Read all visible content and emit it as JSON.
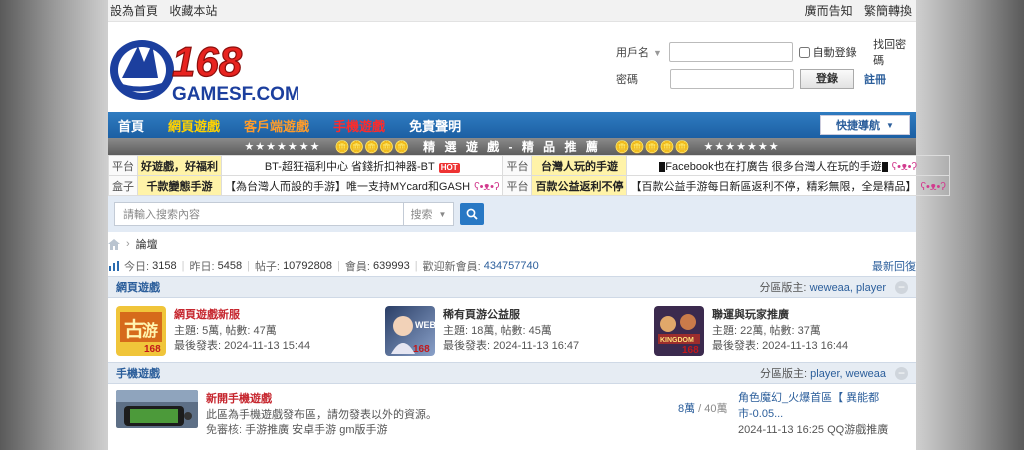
{
  "topbar": {
    "left": [
      "設為首頁",
      "收藏本站"
    ],
    "right": [
      "廣而告知",
      "繁簡轉換"
    ]
  },
  "logo": {
    "number": "168",
    "text": "GAMESF.COM"
  },
  "login": {
    "username_label": "用戶名",
    "password_label": "密碼",
    "remember_label": "自動登錄",
    "login_button": "登錄",
    "forgot_link": "找回密碼",
    "register_link": "註冊"
  },
  "nav": {
    "items": [
      {
        "label": "首頁",
        "color": "#ffffff"
      },
      {
        "label": "網頁遊戲",
        "color": "#ffd200"
      },
      {
        "label": "客戶端遊戲",
        "color": "#ff9c2a"
      },
      {
        "label": "手機遊戲",
        "color": "#ff2b2b"
      },
      {
        "label": "免責聲明",
        "color": "#ffffff"
      }
    ],
    "quick_nav": "快捷導航"
  },
  "banner": {
    "stars_left": "★★★★★★★",
    "coins": "🪙🪙🪙🪙🪙",
    "text": "精 選 遊 戲 - 精 品 推 薦",
    "stars_right": "★★★★★★★"
  },
  "ads": [
    [
      {
        "cat": "平台",
        "hl": "好遊戲，好福利",
        "txt": "BT-超狂福利中心 省錢折扣神器-BT",
        "badge": "HOT"
      },
      {
        "cat": "平台",
        "hl": "台灣人玩的手遊",
        "txt": "Facebook也在打廣告 很多台灣人在玩的手遊"
      }
    ],
    [
      {
        "cat": "盒子",
        "hl": "千款變態手游",
        "txt": "【為台灣人而設的手游】唯一支持MYcard和GASH"
      },
      {
        "cat": "平台",
        "hl": "百款公益返利不停",
        "txt": "【百款公益手游每日新區返利不停，精彩無限，全是精品】"
      }
    ]
  ],
  "search": {
    "placeholder": "請輸入搜索內容",
    "type": "搜索"
  },
  "breadcrumb": {
    "current": "論壇"
  },
  "stats": {
    "today_label": "今日:",
    "today": "3158",
    "yesterday_label": "昨日:",
    "yesterday": "5458",
    "posts_label": "帖子:",
    "posts": "10792808",
    "members_label": "會員:",
    "members": "639993",
    "welcome_label": "歡迎新會員:",
    "welcome": "434757740",
    "latest": "最新回復"
  },
  "sections": [
    {
      "title": "網頁遊戲",
      "mods_label": "分區版主:",
      "mods": "weweaa, player",
      "forums": [
        {
          "name": "網頁遊戲新服",
          "topics": "主題: 5萬, 帖數: 47萬",
          "last": "最後發表: 2024-11-13 15:44"
        },
        {
          "name": "稀有頁游公益服",
          "topics": "主題: 18萬, 帖數: 45萬",
          "last": "最後發表: 2024-11-13 16:47"
        },
        {
          "name": "聯運與玩家推廣",
          "topics": "主題: 22萬, 帖數: 37萬",
          "last": "最後發表: 2024-11-13 16:44"
        }
      ]
    },
    {
      "title": "手機遊戲",
      "mods_label": "分區版主:",
      "mods": "player, weweaa",
      "forum": {
        "name": "新開手機遊戲",
        "desc": "此區為手機遊戲發布區，請勿發表以外的資源。",
        "exempt_label": "免審核:",
        "exempt": "手游推廣 安卓手游 gm版手游",
        "threads": "8萬",
        "posts": "40萬",
        "last_title": "角色魔幻_火爆首區【 異能都市-0.05...",
        "last_meta": "2024-11-13 16:25 QQ游戲推廣"
      }
    }
  ]
}
